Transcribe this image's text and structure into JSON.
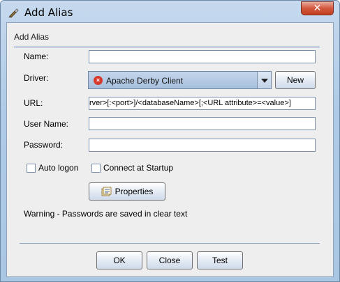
{
  "window": {
    "title": "Add Alias",
    "close_label": "✕"
  },
  "group": {
    "title": "Add Alias"
  },
  "form": {
    "name_label": "Name:",
    "name_value": "",
    "driver_label": "Driver:",
    "driver_value": "Apache Derby Client",
    "new_button": "New",
    "url_label": "URL:",
    "url_value": "rver>[:<port>]/<databaseName>[;<URL attribute>=<value>]",
    "username_label": "User Name:",
    "username_value": "",
    "password_label": "Password:",
    "password_value": "",
    "auto_logon_label": "Auto logon",
    "auto_logon_checked": false,
    "connect_startup_label": "Connect at Startup",
    "connect_startup_checked": false,
    "properties_button": "Properties",
    "warning": "Warning - Passwords are saved in clear text"
  },
  "buttons": {
    "ok": "OK",
    "close": "Close",
    "test": "Test"
  },
  "colors": {
    "error_icon": "#d63a2c",
    "accent_line": "#5577bb"
  }
}
